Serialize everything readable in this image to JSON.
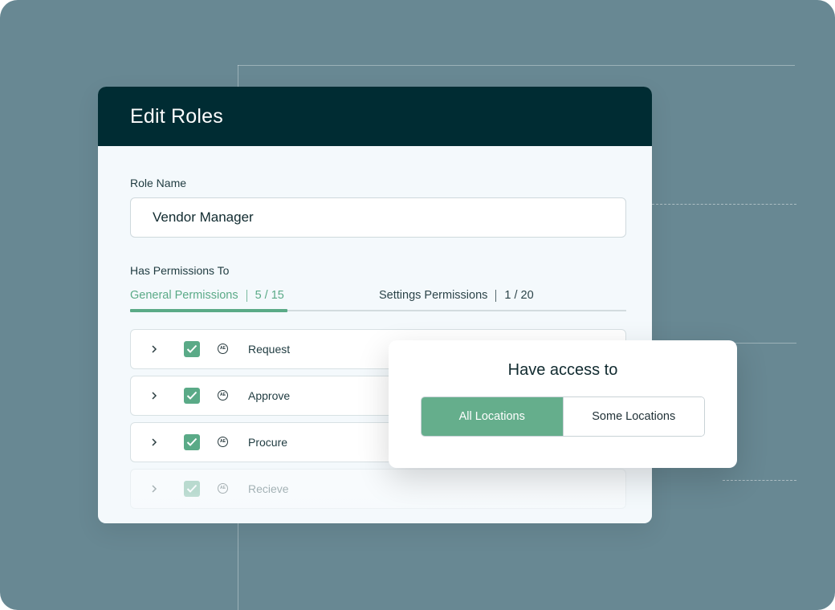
{
  "modal": {
    "title": "Edit Roles",
    "role_name_label": "Role Name",
    "role_name_value": "Vendor Manager",
    "permissions_label": "Has Permissions To",
    "tabs": [
      {
        "label": "General Permissions",
        "count": "5 / 15",
        "active": true
      },
      {
        "label": "Settings Permissions",
        "count": "1 / 20",
        "active": false
      }
    ],
    "permissions": [
      {
        "label": "Request",
        "checked": true,
        "icon": "circle-badge-icon"
      },
      {
        "label": "Approve",
        "checked": true,
        "icon": "circle-badge-icon"
      },
      {
        "label": "Procure",
        "checked": true,
        "icon": "circle-badge-icon"
      },
      {
        "label": "Recieve",
        "checked": true,
        "icon": "circle-badge-icon"
      }
    ]
  },
  "popup": {
    "title": "Have access to",
    "options": [
      {
        "label": "All Locations",
        "selected": true
      },
      {
        "label": "Some Locations",
        "selected": false
      }
    ]
  },
  "colors": {
    "background": "#688893",
    "header": "#002c33",
    "accent": "#5aaa87",
    "surface": "#f4f9fc"
  }
}
